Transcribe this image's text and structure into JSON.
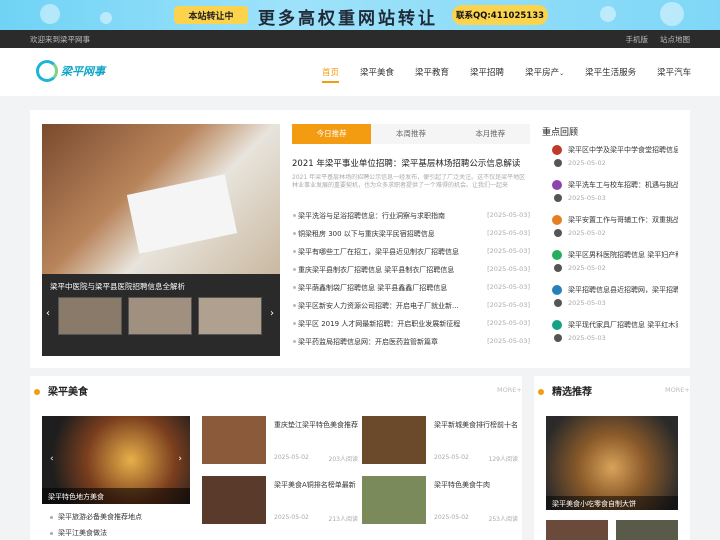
{
  "banner": {
    "tag": "本站转让中",
    "headline": "更多高权重网站转让",
    "contact": "联系QQ:411025133"
  },
  "topbar": {
    "welcome": "欢迎来到梁平网事",
    "links": [
      "手机版",
      "站点地图"
    ]
  },
  "header": {
    "logo_text": "梁平网事",
    "nav": [
      "首页",
      "梁平美食",
      "梁平教育",
      "梁平招聘",
      "梁平房产",
      "梁平生活服务",
      "梁平汽车"
    ],
    "active_index": 0
  },
  "slider": {
    "caption": "梁平中医院与梁平县医院招聘信息全解析"
  },
  "tabs": [
    "今日推荐",
    "本周推荐",
    "本月推荐"
  ],
  "headline": {
    "title": "2021 年梁平事业单位招聘：梁平基层林场招聘公示信息解读",
    "summary": "2021 年梁平基层林场的招聘公示信息一经发布，便引起了广泛关注。这不仅是梁平地区林业事业发展的重要契机，也为众多求职者提供了一个难得的机会。让我们一起来"
  },
  "news": [
    {
      "title": "梁平洗浴与足浴招聘信息：行业洞察与求职指南",
      "date": "[2025-05-03]"
    },
    {
      "title": "铜梁租房 300 以下与重庆梁平民宿招聘信息",
      "date": "[2025-05-03]"
    },
    {
      "title": "梁平有哪些工厂在招工，梁平县近见制衣厂招聘信息",
      "date": "[2025-05-03]"
    },
    {
      "title": "重庆梁平县制衣厂招聘信息 梁平县制衣厂招聘信息",
      "date": "[2025-05-03]"
    },
    {
      "title": "梁平荫鑫制袋厂招聘信息 梁平县鑫鑫厂招聘信息",
      "date": "[2025-05-03]"
    },
    {
      "title": "梁平区新安人力资源公司招聘：开启电子厂就业新...",
      "date": "[2025-05-03]"
    },
    {
      "title": "梁平区 2019 人才网最新招聘：开启职业发展新征程",
      "date": "[2025-05-03]"
    },
    {
      "title": "梁平药监局招聘信息网：开启医药监管新篇章",
      "date": "[2025-05-03]"
    }
  ],
  "sidebar": {
    "title": "重点回顾",
    "items": [
      {
        "title": "梁平区中学及梁平中学食堂招聘信息...",
        "date": "2025-05-02"
      },
      {
        "title": "梁平洗车工与校车招聘：机遇与挑战",
        "date": "2025-05-03"
      },
      {
        "title": "梁平安置工作与哥辅工作：双重挑战...",
        "date": "2025-05-02"
      },
      {
        "title": "梁平区男科医院招聘信息 梁平妇产科...",
        "date": "2025-05-02"
      },
      {
        "title": "梁平招聘信息县近招聘网，梁平招聘...",
        "date": "2025-05-03"
      },
      {
        "title": "梁平现代家具厂招聘信息 梁平红木家...",
        "date": "2025-05-03"
      }
    ]
  },
  "food": {
    "title": "梁平美食",
    "more": "MORE+",
    "big_caption": "梁平特色地方美食",
    "list": [
      "梁平旅游必备美食推荐地点",
      "梁平江美食做法"
    ],
    "cards": [
      {
        "title": "重庆垫江梁平特色美食推荐",
        "date": "2025-05-02",
        "reads": "203人阅读",
        "color": "#8a5a3a"
      },
      {
        "title": "梁平新城美食排行榜前十名",
        "date": "2025-05-02",
        "reads": "129人阅读",
        "color": "#6a4a2a"
      },
      {
        "title": "梁平美食A铜排名榜单最新",
        "date": "2025-05-02",
        "reads": "213人阅读",
        "color": "#5a3a2a"
      },
      {
        "title": "梁平特色美食牛肉",
        "date": "2025-05-02",
        "reads": "253人阅读",
        "color": "#7a8a5a"
      }
    ]
  },
  "pick": {
    "title": "精选推荐",
    "more": "MORE+",
    "caption": "梁平美食小吃零食自制大饼"
  }
}
